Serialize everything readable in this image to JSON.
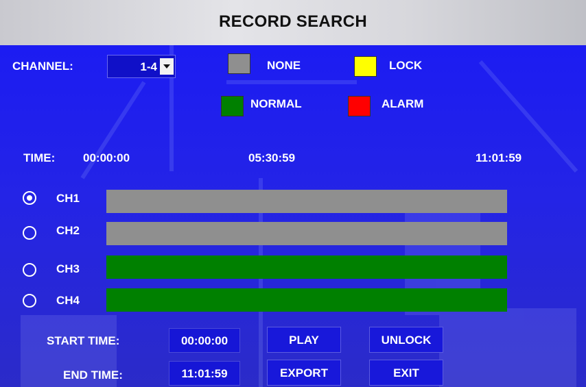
{
  "title": "RECORD SEARCH",
  "channel": {
    "label": "CHANNEL:",
    "selected": "1-4"
  },
  "legend": [
    {
      "label": "NONE",
      "color": "#8f8f8f"
    },
    {
      "label": "LOCK",
      "color": "#ffff00"
    },
    {
      "label": "NORMAL",
      "color": "#008000"
    },
    {
      "label": "ALARM",
      "color": "#ff0000"
    }
  ],
  "timeline": {
    "label": "TIME:",
    "start": "00:00:00",
    "mid": "05:30:59",
    "end": "11:01:59"
  },
  "channels": [
    {
      "label": "CH1",
      "selected": true,
      "status": "NONE",
      "color": "#8f8f8f"
    },
    {
      "label": "CH2",
      "selected": false,
      "status": "NONE",
      "color": "#8f8f8f"
    },
    {
      "label": "CH3",
      "selected": false,
      "status": "NORMAL",
      "color": "#008000"
    },
    {
      "label": "CH4",
      "selected": false,
      "status": "NORMAL",
      "color": "#008000"
    }
  ],
  "start_time": {
    "label": "START TIME:",
    "value": "00:00:00"
  },
  "end_time": {
    "label": "END TIME:",
    "value": "11:01:59"
  },
  "buttons": {
    "play": "PLAY",
    "unlock": "UNLOCK",
    "export": "EXPORT",
    "exit": "EXIT"
  }
}
